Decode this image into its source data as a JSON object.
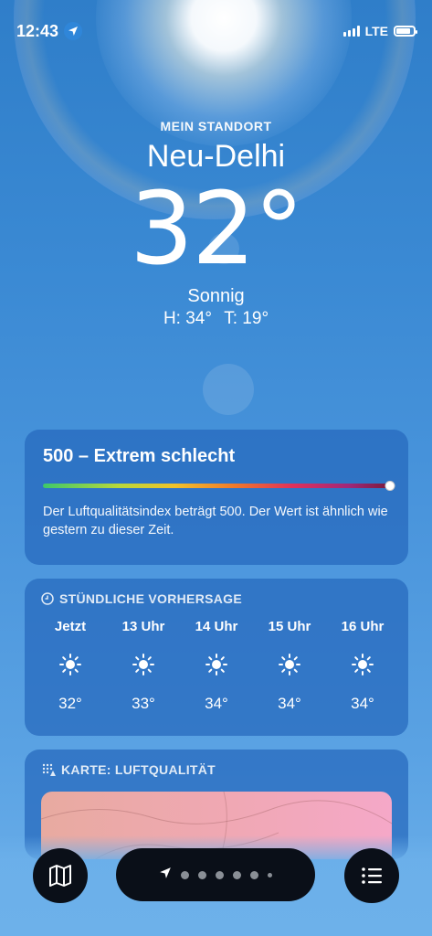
{
  "status_bar": {
    "time": "12:43",
    "network": "LTE"
  },
  "location": {
    "label": "MEIN STANDORT",
    "city": "Neu-Delhi"
  },
  "current": {
    "temperature": "32°",
    "condition": "Sonnig",
    "high": "H: 34°",
    "low": "T: 19°"
  },
  "air_quality": {
    "title": "500 – Extrem schlecht",
    "index_fraction": 1.0,
    "description": "Der Luftqualitätsindex beträgt 500. Der Wert ist ähnlich wie gestern zu dieser Zeit."
  },
  "hourly": {
    "header": "STÜNDLICHE VORHERSAGE",
    "items": [
      {
        "label": "Jetzt",
        "icon": "sun-icon",
        "temp": "32°"
      },
      {
        "label": "13 Uhr",
        "icon": "sun-icon",
        "temp": "33°"
      },
      {
        "label": "14 Uhr",
        "icon": "sun-icon",
        "temp": "34°"
      },
      {
        "label": "15 Uhr",
        "icon": "sun-icon",
        "temp": "34°"
      },
      {
        "label": "16 Uhr",
        "icon": "sun-icon",
        "temp": "34°"
      }
    ]
  },
  "map_section": {
    "header": "KARTE: LUFTQUALITÄT"
  },
  "bottom_bar": {
    "page_count": 7,
    "current_page": 0
  },
  "colors": {
    "background": "#3b8ad4",
    "card": "#2668bc",
    "button_dark": "#0a0f18"
  }
}
